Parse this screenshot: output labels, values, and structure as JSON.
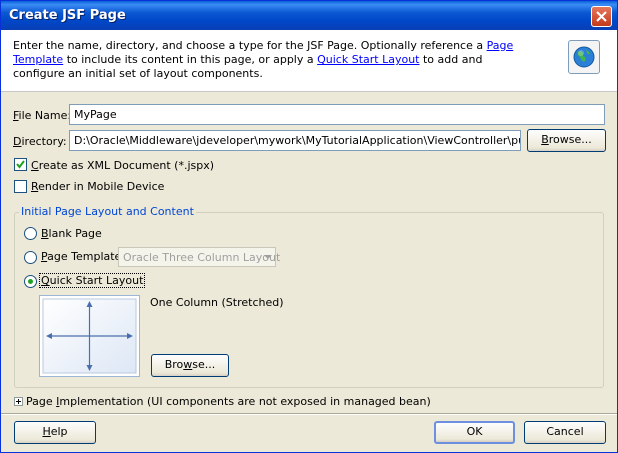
{
  "window": {
    "title": "Create JSF Page"
  },
  "header": {
    "text_1": "Enter the name, directory, and choose a type for the JSF Page. Optionally reference a ",
    "link_page_template": "Page Template",
    "text_2": " to include its content in this page, or apply a ",
    "link_quick_start": "Quick Start Layout",
    "text_3": " to add and configure an initial set of layout components.",
    "icon": "globe-icon"
  },
  "form": {
    "file_name_label_key": "F",
    "file_name_label_rest": "ile Name:",
    "file_name_value": "MyPage",
    "directory_label_key": "D",
    "directory_label_rest": "irectory:",
    "directory_value": "D:\\Oracle\\Middleware\\jdeveloper\\mywork\\MyTutorialApplication\\ViewController\\public_html",
    "browse_key": "B",
    "browse_rest": "rowse...",
    "xml_checkbox_key": "C",
    "xml_checkbox_rest": "reate as XML Document (*.jspx)",
    "xml_checked": true,
    "mobile_checkbox_key": "R",
    "mobile_checkbox_rest": "ender in Mobile Device",
    "mobile_checked": false
  },
  "layout_group": {
    "title": "Initial Page Layout and Content",
    "blank_key": "B",
    "blank_rest": "lank Page",
    "template_key": "P",
    "template_rest": "age Template",
    "template_select_value": "Oracle Three Column Layout",
    "quick_key": "Q",
    "quick_rest": "uick Start Layout",
    "selected": "quick_start",
    "layout_name": "One Column (Stretched)",
    "browse_key": "w",
    "browse_pre": "Bro",
    "browse_post": "se..."
  },
  "implementation": {
    "label_key": "I",
    "label_pre": "Page ",
    "label_rest": "mplementation",
    "note": "(UI components are not exposed in managed bean)"
  },
  "footer": {
    "help_key": "H",
    "help_rest": "elp",
    "ok_label": "OK",
    "cancel_label": "Cancel"
  },
  "colors": {
    "titlebar": "#0a5fd8",
    "dialog_bg": "#ece9d8",
    "link": "#0000ff",
    "group_title": "#0046d5",
    "radio_selected": "#21a121"
  }
}
